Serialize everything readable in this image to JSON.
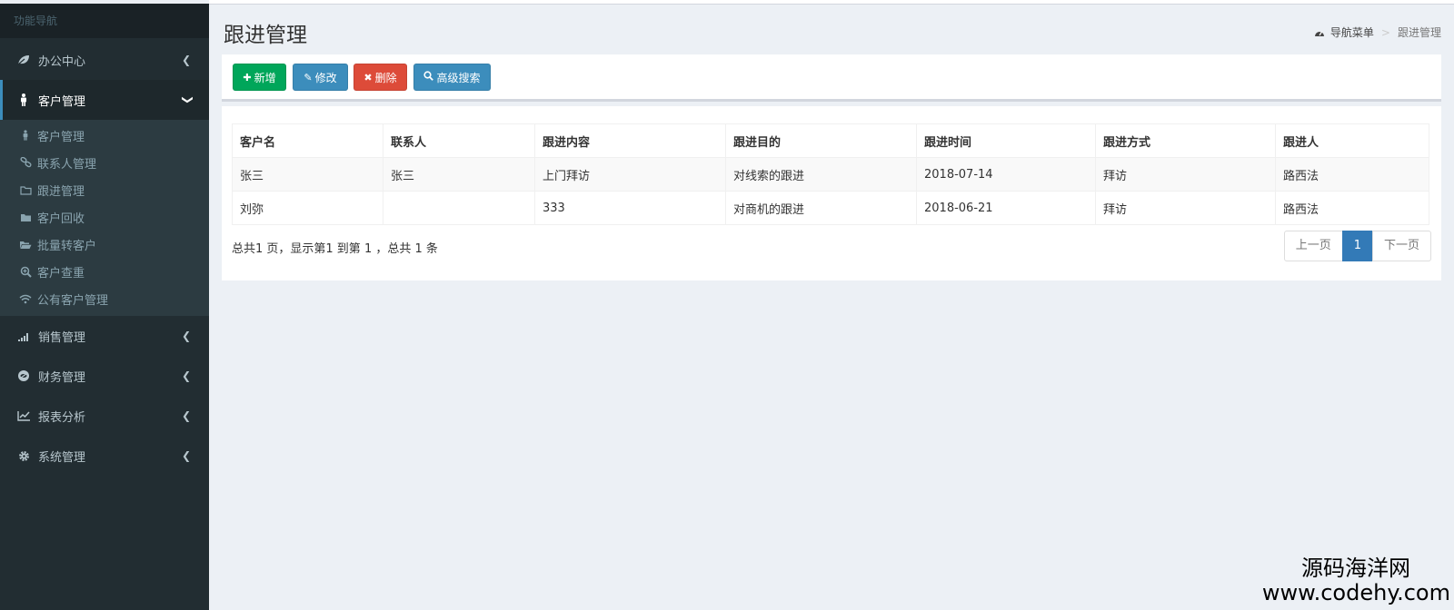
{
  "sidebar": {
    "header": "功能导航",
    "items": [
      {
        "label": "办公中心",
        "icon": "leaf-icon"
      },
      {
        "label": "客户管理",
        "icon": "male-icon",
        "active": true
      },
      {
        "label": "销售管理",
        "icon": "signal-icon"
      },
      {
        "label": "财务管理",
        "icon": "eye-slash-icon"
      },
      {
        "label": "报表分析",
        "icon": "line-chart-icon"
      },
      {
        "label": "系统管理",
        "icon": "gear-icon"
      }
    ],
    "submenu": [
      {
        "label": "客户管理",
        "icon": "male-icon"
      },
      {
        "label": "联系人管理",
        "icon": "link-icon"
      },
      {
        "label": "跟进管理",
        "icon": "folder-o-icon"
      },
      {
        "label": "客户回收",
        "icon": "folder-icon"
      },
      {
        "label": "批量转客户",
        "icon": "folder-open-icon"
      },
      {
        "label": "客户查重",
        "icon": "search-plus-icon"
      },
      {
        "label": "公有客户管理",
        "icon": "wifi-icon"
      }
    ]
  },
  "page": {
    "title": "跟进管理",
    "breadcrumb": {
      "home": "导航菜单",
      "separator": ">",
      "current": "跟进管理"
    }
  },
  "toolbar": {
    "add_label": "新增",
    "edit_label": "修改",
    "delete_label": "删除",
    "search_label": "高级搜索"
  },
  "table": {
    "columns": [
      "客户名",
      "联系人",
      "跟进内容",
      "跟进目的",
      "跟进时间",
      "跟进方式",
      "跟进人"
    ],
    "rows": [
      [
        "张三",
        "张三",
        "上门拜访",
        "对线索的跟进",
        "2018-07-14",
        "拜访",
        "路西法"
      ],
      [
        "刘弥",
        "",
        "333",
        "对商机的跟进",
        "2018-06-21",
        "拜访",
        "路西法"
      ]
    ]
  },
  "pagination": {
    "summary": "总共1 页，显示第1 到第 1 ，总共 1 条",
    "prev": "上一页",
    "current": "1",
    "next": "下一页"
  },
  "watermark": {
    "line1": "源码海洋网",
    "line2": "www.codehy.com"
  },
  "colors": {
    "sidebar_bg": "#222d32",
    "submenu_bg": "#2c3b41",
    "content_bg": "#ecf0f5",
    "btn_success": "#00a65a",
    "btn_primary": "#3c8dbc",
    "btn_danger": "#dd4b39",
    "pager_active": "#337ab7"
  }
}
